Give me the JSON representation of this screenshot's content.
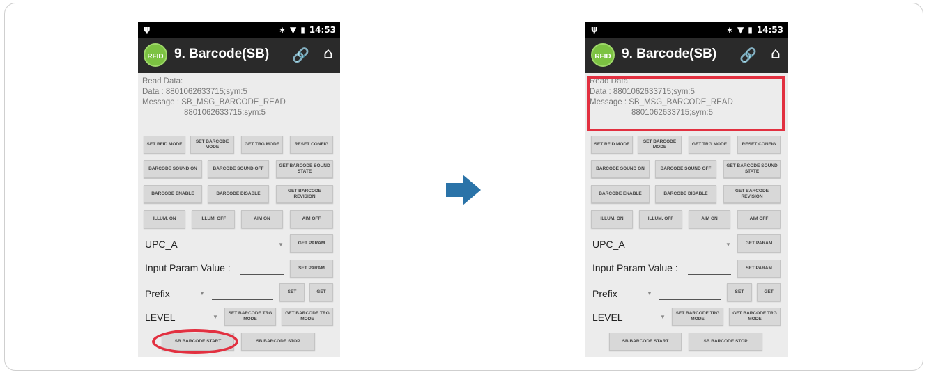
{
  "colors": {
    "highlight": "#e23040",
    "arrow": "#2a73a8",
    "rfid_logo": "#7cc242",
    "app_bar": "#2a2a2a"
  },
  "status_bar": {
    "time": "14:53"
  },
  "app": {
    "logo_text": "RFID",
    "title": "9. Barcode(SB)"
  },
  "read": {
    "label": "Read Data:",
    "data": "Data : 8801062633715;sym:5",
    "message": "Message : SB_MSG_BARCODE_READ",
    "message_cont": "8801062633715;sym:5"
  },
  "buttons": {
    "set_rfid_mode": "SET RFID MODE",
    "set_barcode_mode": "SET BARCODE MODE",
    "get_trg_mode": "GET TRG MODE",
    "reset_config": "RESET CONFIG",
    "barcode_sound_on": "BARCODE SOUND ON",
    "barcode_sound_off": "BARCODE SOUND OFF",
    "get_barcode_sound_state": "GET BARCODE SOUND STATE",
    "barcode_enable": "BARCODE ENABLE",
    "barcode_disable": "BARCODE DISABLE",
    "get_barcode_revision": "GET BARCODE REVISION",
    "illum_on": "ILLUM. ON",
    "illum_off": "ILLUM. OFF",
    "aim_on": "AIM ON",
    "aim_off": "AIM OFF",
    "get_param": "GET PARAM",
    "set_param": "SET PARAM",
    "set": "SET",
    "get": "GET",
    "set_barcode_trg_mode": "SET BARCODE TRG MODE",
    "get_barcode_trg_mode": "GET BARCODE TRG MODE",
    "sb_barcode_start": "SB BARCODE START",
    "sb_barcode_stop": "SB BARCODE STOP"
  },
  "fields": {
    "symbology_value": "UPC_A",
    "input_param_label": "Input Param Value :",
    "prefix_value": "Prefix",
    "level_value": "LEVEL"
  }
}
